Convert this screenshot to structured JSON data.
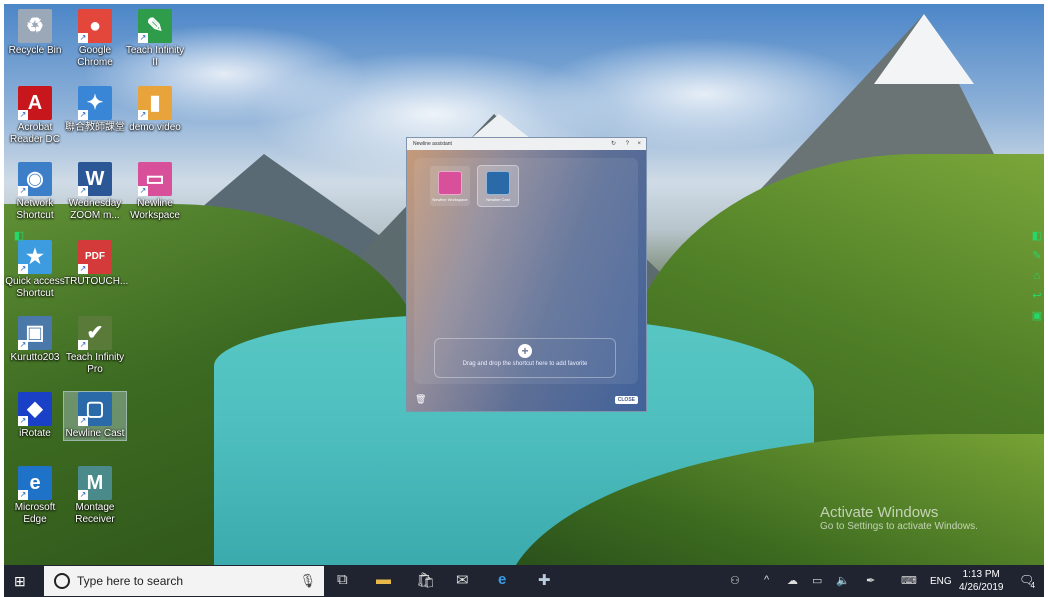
{
  "desktop": {
    "icons": [
      {
        "label": "Recycle Bin",
        "icon": "recycle-bin-icon",
        "glyph": "♻",
        "color": "#9aa8b8"
      },
      {
        "label": "Google Chrome",
        "icon": "chrome-icon",
        "glyph": "●",
        "color": "#e3463a"
      },
      {
        "label": "Teach Infinity II",
        "icon": "teach-infinity-icon",
        "glyph": "✎",
        "color": "#2e9c4a"
      },
      {
        "label": "Acrobat Reader DC",
        "icon": "acrobat-icon",
        "glyph": "A",
        "color": "#c8161d"
      },
      {
        "label": "聯合教師課堂",
        "icon": "classroom-icon",
        "glyph": "✦",
        "color": "#3a86d6"
      },
      {
        "label": "demo video",
        "icon": "folder-video-icon",
        "glyph": "▮",
        "color": "#e8a33a"
      },
      {
        "label": "Network Shortcut",
        "icon": "network-icon",
        "glyph": "◉",
        "color": "#3c7fc8"
      },
      {
        "label": "Wednesday ZOOM m...",
        "icon": "word-doc-icon",
        "glyph": "W",
        "color": "#2b5797"
      },
      {
        "label": "Newline Workspace",
        "icon": "newline-workspace-icon",
        "glyph": "▭",
        "color": "#d8509a"
      },
      {
        "label": "Quick access Shortcut",
        "icon": "star-icon",
        "glyph": "★",
        "color": "#3d9be0"
      },
      {
        "label": "TRUTOUCH...",
        "icon": "pdf-icon",
        "glyph": "PDF",
        "color": "#d43a3a"
      },
      {
        "label": "Kurutto203",
        "icon": "kurutto-icon",
        "glyph": "▣",
        "color": "#4a78a8"
      },
      {
        "label": "Teach Infinity Pro",
        "icon": "teach-infinity-pro-icon",
        "glyph": "✔",
        "color": "#5a7a3a"
      },
      {
        "label": "iRotate",
        "icon": "irotate-icon",
        "glyph": "◆",
        "color": "#1a40c8"
      },
      {
        "label": "Newline Cast",
        "icon": "newline-cast-icon",
        "glyph": "▢",
        "color": "#2a6aa8"
      },
      {
        "label": "Microsoft Edge",
        "icon": "edge-icon",
        "glyph": "e",
        "color": "#1e73c8"
      },
      {
        "label": "Montage Receiver",
        "icon": "montage-icon",
        "glyph": "M",
        "color": "#4a8a8a"
      }
    ]
  },
  "assistant": {
    "title": "Newline assistant",
    "controls": [
      "↻",
      "?",
      "×"
    ],
    "tiles": [
      {
        "label": "Newline Workspace",
        "color": "#d8509a"
      },
      {
        "label": "Newline Cast",
        "color": "#2a6aa8"
      }
    ],
    "drop_text": "Drag and drop the shortcut here to add favorite",
    "close_label": "CLOSE"
  },
  "watermark": {
    "line1": "Activate Windows",
    "line2": "Go to Settings to activate Windows."
  },
  "taskbar": {
    "search_placeholder": "Type here to search",
    "language": "ENG",
    "time": "1:13 PM",
    "date": "4/26/2019",
    "notifications": "4"
  }
}
